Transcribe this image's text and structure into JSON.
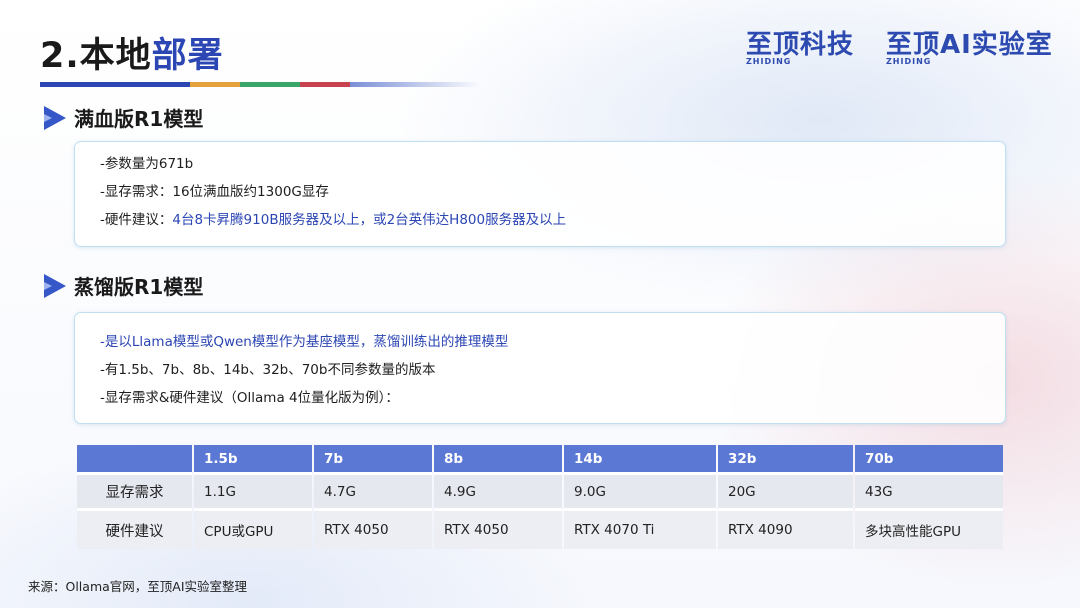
{
  "title": {
    "part1": "2.本地",
    "part2": "部署"
  },
  "logos": [
    {
      "main": "至顶科技",
      "sub": "ZHIDING"
    },
    {
      "main": "至顶AI实验室",
      "sub": "ZHIDING"
    }
  ],
  "colors": {
    "accent": "#2c46b4",
    "table_header": "#5b78d4",
    "box_border": "#bfe0f0"
  },
  "section1": {
    "heading": "满血版R1模型",
    "lines": [
      "-参数量为671b",
      "-显存需求：16位满血版约1300G显存",
      {
        "prefix": "-硬件建议：",
        "highlight": "4台8卡昇腾910B服务器及以上，或2台英伟达H800服务器及以上"
      }
    ]
  },
  "section2": {
    "heading": "蒸馏版R1模型",
    "lines": [
      "-是以Llama模型或Qwen模型作为基座模型，蒸馏训练出的推理模型",
      "-有1.5b、7b、8b、14b、32b、70b不同参数量的版本",
      "-显存需求&硬件建议（Ollama 4位量化版为例）："
    ]
  },
  "table": {
    "headers": [
      "",
      "1.5b",
      "7b",
      "8b",
      "14b",
      "32b",
      "70b"
    ],
    "rows": [
      {
        "label": "显存需求",
        "cells": [
          "1.1G",
          "4.7G",
          "4.9G",
          "9.0G",
          "20G",
          "43G"
        ]
      },
      {
        "label": "硬件建议",
        "cells": [
          "CPU或GPU",
          "RTX 4050",
          "RTX 4050",
          "RTX 4070 Ti",
          "RTX 4090",
          "多块高性能GPU"
        ]
      }
    ]
  },
  "source": "来源：Ollama官网，至顶AI实验室整理"
}
